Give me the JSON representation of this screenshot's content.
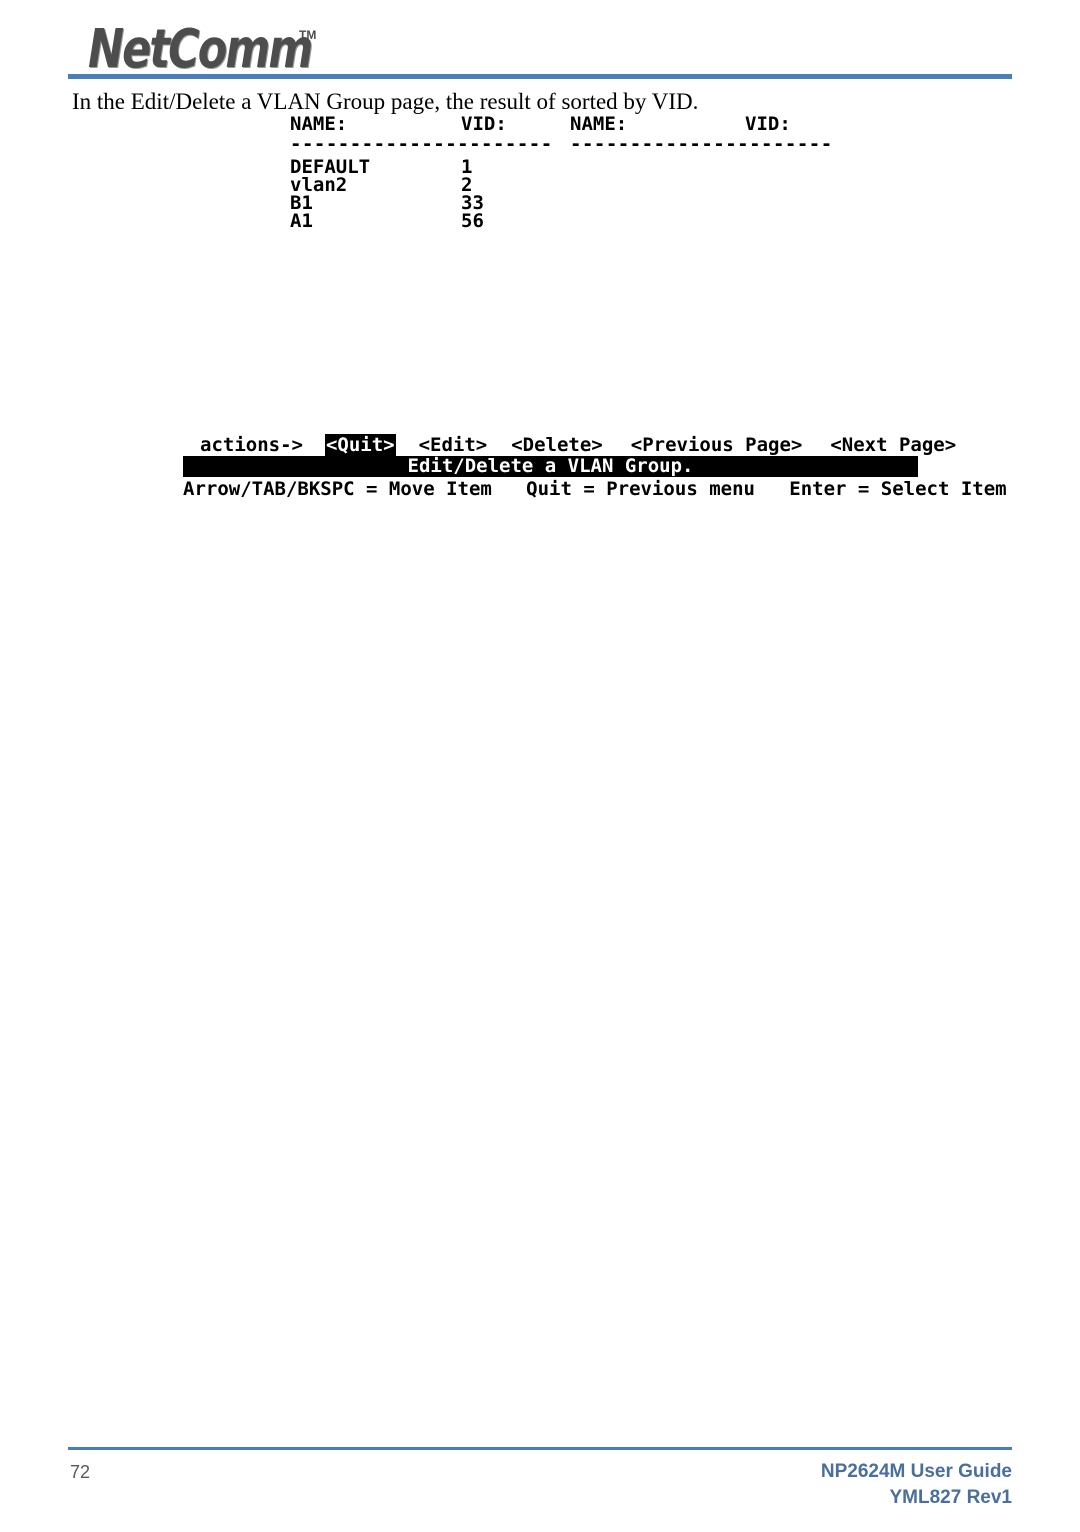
{
  "header": {
    "brand": "NetComm",
    "trademark": "TM",
    "rule_color": "#4a7ebb"
  },
  "body": {
    "paragraph": "In the Edit/Delete a VLAN Group page, the result of sorted by VID."
  },
  "terminal": {
    "columns_left": {
      "name_header": "NAME:",
      "vid_header": "VID:",
      "separator": "----------------------"
    },
    "columns_right": {
      "name_header": "NAME:",
      "vid_header": "VID:",
      "separator": "----------------------"
    },
    "rows_left": [
      {
        "name": "DEFAULT",
        "vid": "1"
      },
      {
        "name": "vlan2",
        "vid": "2"
      },
      {
        "name": "B1",
        "vid": "33"
      },
      {
        "name": "A1",
        "vid": "56"
      }
    ],
    "rows_right": [],
    "actions_label": "actions->",
    "actions": [
      {
        "label": "<Quit>",
        "selected": true
      },
      {
        "label": "<Edit>",
        "selected": false
      },
      {
        "label": "<Delete>",
        "selected": false
      },
      {
        "label": "<Previous Page>",
        "selected": false
      },
      {
        "label": "<Next Page>",
        "selected": false
      }
    ],
    "status_bar": "Edit/Delete a VLAN Group.",
    "help_line": "Arrow/TAB/BKSPC = Move Item   Quit = Previous menu   Enter = Select Item"
  },
  "footer": {
    "page_number": "72",
    "guide_title": "NP2624M User Guide",
    "revision": "YML827 Rev1"
  }
}
